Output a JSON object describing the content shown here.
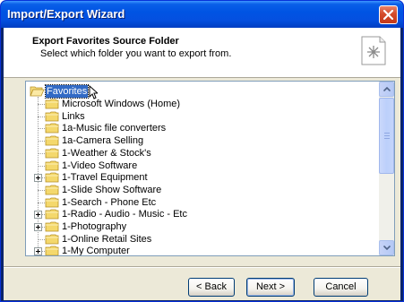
{
  "window": {
    "title": "Import/Export Wizard"
  },
  "header": {
    "title": "Export Favorites Source Folder",
    "subtitle": "Select which folder you want to export from."
  },
  "tree": {
    "root_label": "Favorites",
    "items": [
      {
        "label": "Microsoft Windows (Home)",
        "expandable": false
      },
      {
        "label": "Links",
        "expandable": false
      },
      {
        "label": "1a-Music file converters",
        "expandable": false
      },
      {
        "label": "1a-Camera Selling",
        "expandable": false
      },
      {
        "label": "1-Weather & Stock's",
        "expandable": false
      },
      {
        "label": "1-Video Software",
        "expandable": false
      },
      {
        "label": "1-Travel Equipment",
        "expandable": true
      },
      {
        "label": "1-Slide Show Software",
        "expandable": false
      },
      {
        "label": "1-Search - Phone Etc",
        "expandable": false
      },
      {
        "label": "1-Radio - Audio - Music - Etc",
        "expandable": true
      },
      {
        "label": "1-Photography",
        "expandable": true
      },
      {
        "label": "1-Online Retail Sites",
        "expandable": false
      },
      {
        "label": "1-My Computer",
        "expandable": true
      }
    ]
  },
  "buttons": {
    "back": "< Back",
    "next": "Next >",
    "cancel": "Cancel"
  },
  "colors": {
    "titlebar": "#0054e3",
    "selection": "#316ac5",
    "folder": "#f4d86c",
    "dialog_bg": "#ece9d8"
  },
  "icons": {
    "close": "close-icon",
    "header": "favorites-page-icon",
    "folder": "folder-icon"
  }
}
